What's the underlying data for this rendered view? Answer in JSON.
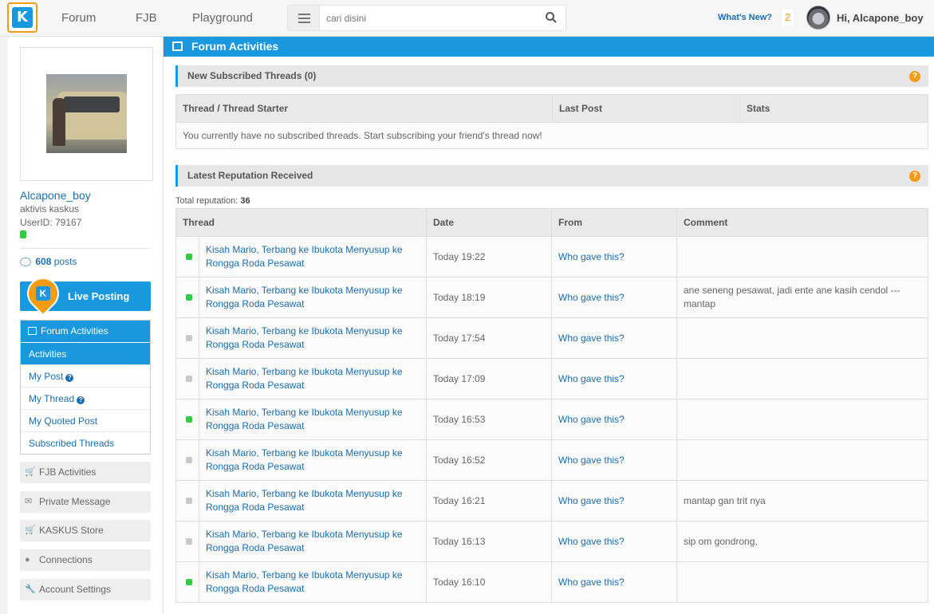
{
  "nav": {
    "items": [
      "Forum",
      "FJB",
      "Playground"
    ],
    "search_placeholder": "cari disini",
    "whats_new": "What's New?",
    "notification_count": "2",
    "greeting": "Hi, Alcapone_boy"
  },
  "profile": {
    "username": "Alcapone_boy",
    "title": "aktivis kaskus",
    "user_id": "UserID: 79167",
    "posts_count": "608",
    "posts_label": "posts"
  },
  "sidebar": {
    "live_posting": "Live Posting",
    "forum_activities": "Forum Activities",
    "menu": [
      "Activities",
      "My Post",
      "My Thread",
      "My Quoted Post",
      "Subscribed Threads"
    ],
    "buttons": [
      "FJB Activities",
      "Private Message",
      "KASKUS Store",
      "Connections",
      "Account Settings"
    ]
  },
  "main": {
    "title": "Forum Activities",
    "subscribed": {
      "heading": "New Subscribed Threads (0)",
      "columns": [
        "Thread / Thread Starter",
        "Last Post",
        "Stats"
      ],
      "empty": "You currently have no subscribed threads. Start subscribing your friend's thread now!"
    },
    "reputation": {
      "heading": "Latest Reputation Received",
      "total_label": "Total reputation:",
      "total": "36",
      "columns": [
        "Thread",
        "Date",
        "From",
        "Comment"
      ],
      "rows": [
        {
          "status": "green",
          "thread": "Kisah Mario, Terbang ke Ibukota Menyusup ke Rongga Roda Pesawat",
          "date": "Today 19:22",
          "from": "Who gave this?",
          "comment": ""
        },
        {
          "status": "green",
          "thread": "Kisah Mario, Terbang ke Ibukota Menyusup ke Rongga Roda Pesawat",
          "date": "Today 18:19",
          "from": "Who gave this?",
          "comment": "ane seneng pesawat, jadi ente ane kasih cendol --- mantap"
        },
        {
          "status": "grey",
          "thread": "Kisah Mario, Terbang ke Ibukota Menyusup ke Rongga Roda Pesawat",
          "date": "Today 17:54",
          "from": "Who gave this?",
          "comment": ""
        },
        {
          "status": "grey",
          "thread": "Kisah Mario, Terbang ke Ibukota Menyusup ke Rongga Roda Pesawat",
          "date": "Today 17:09",
          "from": "Who gave this?",
          "comment": ""
        },
        {
          "status": "green",
          "thread": "Kisah Mario, Terbang ke Ibukota Menyusup ke Rongga Roda Pesawat",
          "date": "Today 16:53",
          "from": "Who gave this?",
          "comment": ""
        },
        {
          "status": "grey",
          "thread": "Kisah Mario, Terbang ke Ibukota Menyusup ke Rongga Roda Pesawat",
          "date": "Today 16:52",
          "from": "Who gave this?",
          "comment": ""
        },
        {
          "status": "grey",
          "thread": "Kisah Mario, Terbang ke Ibukota Menyusup ke Rongga Roda Pesawat",
          "date": "Today 16:21",
          "from": "Who gave this?",
          "comment": "mantap gan trit nya"
        },
        {
          "status": "grey",
          "thread": "Kisah Mario, Terbang ke Ibukota Menyusup ke Rongga Roda Pesawat",
          "date": "Today 16:13",
          "from": "Who gave this?",
          "comment": "sip om gondrong,"
        },
        {
          "status": "green",
          "thread": "Kisah Mario, Terbang ke Ibukota Menyusup ke Rongga Roda Pesawat",
          "date": "Today 16:10",
          "from": "Who gave this?",
          "comment": ""
        }
      ]
    }
  },
  "colors": {
    "accent": "#1998e0",
    "brand_orange": "#f39c12",
    "online": "#2ecc40"
  }
}
